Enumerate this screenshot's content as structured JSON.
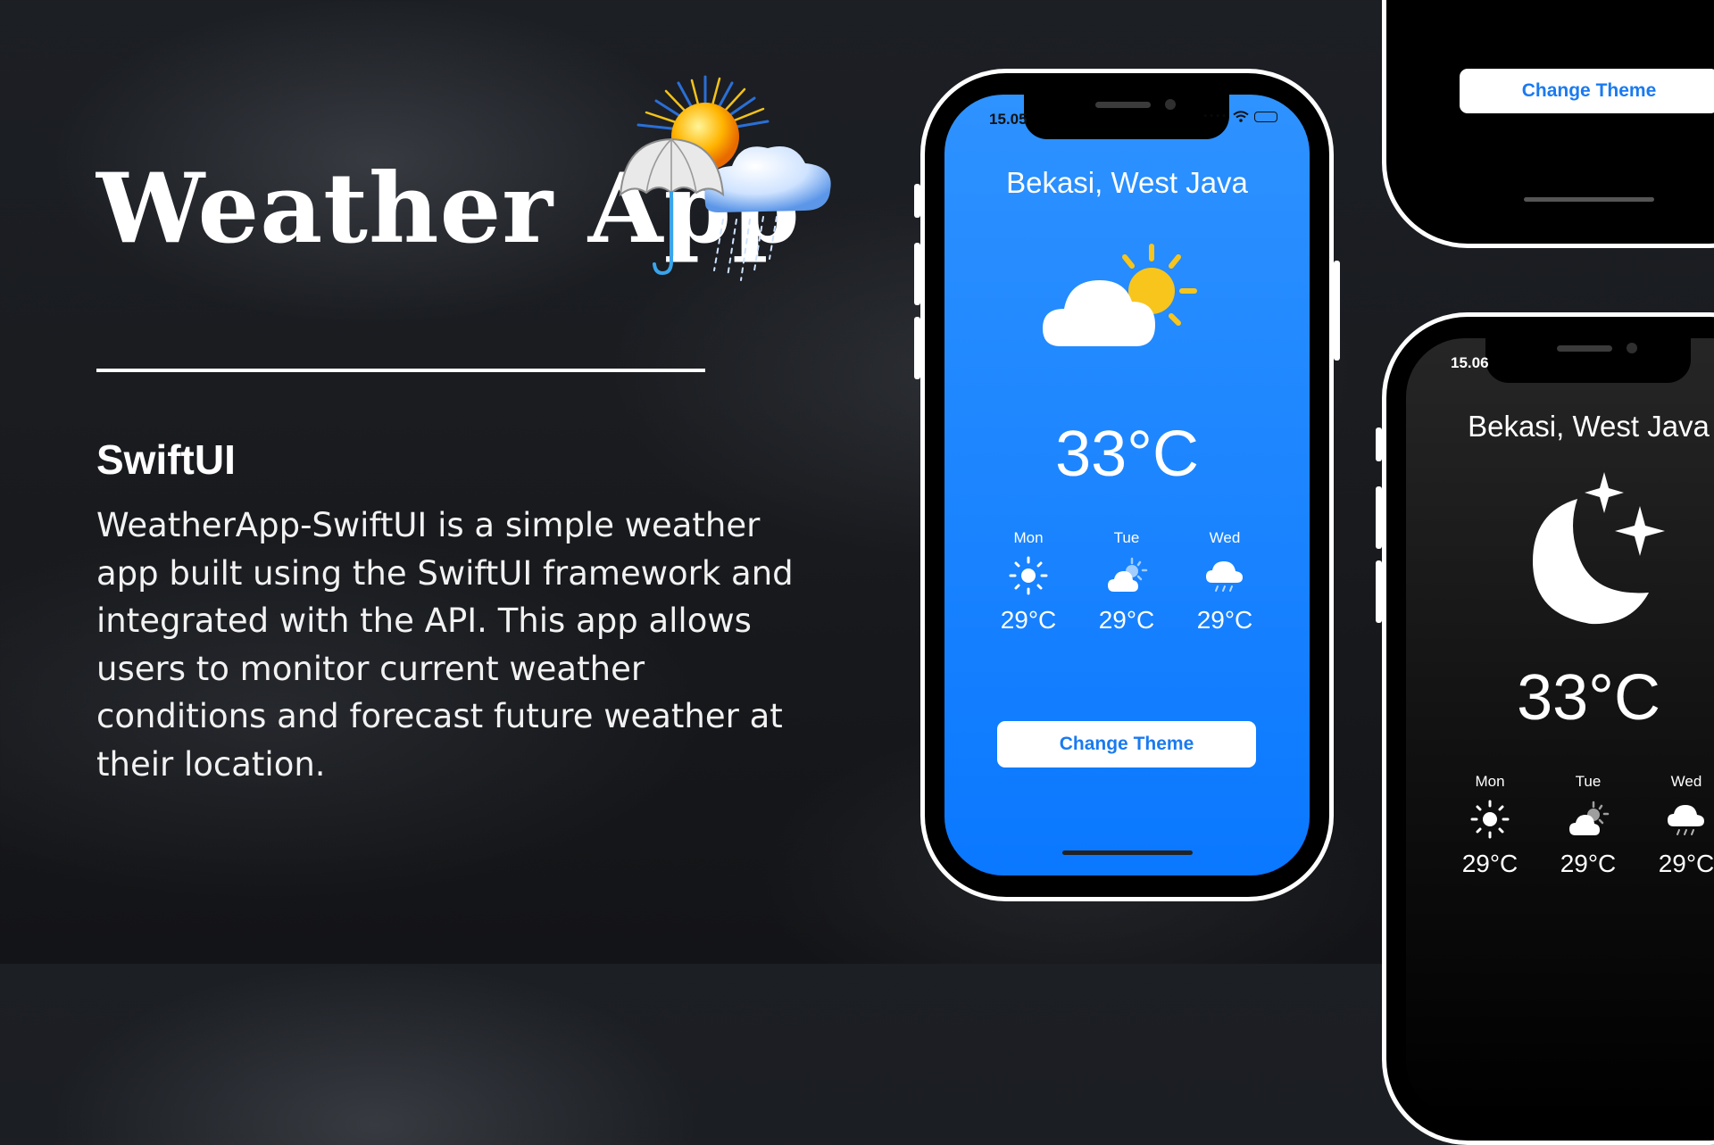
{
  "promo": {
    "title": "Weather App",
    "subtitle": "SwiftUI",
    "description": "WeatherApp-SwiftUI is a simple weather app built using the SwiftUI framework and integrated with the API. This app allows users to monitor current weather conditions and forecast future weather at their location."
  },
  "icons": {
    "logo": "weather-logo-sun-umbrella-cloud",
    "current_light": "partly-cloudy-icon",
    "current_dark": "moon-stars-icon",
    "forecast": [
      "sun-icon",
      "sun-behind-cloud-icon",
      "cloud-drizzle-icon"
    ]
  },
  "colors": {
    "light_screen_top": "#2e92ff",
    "light_screen_bottom": "#0a78ff",
    "dark_screen_top": "#262626",
    "dark_screen_bottom": "#000000",
    "button_text": "#1a7af0",
    "sun": "#f8c51c"
  },
  "phone_light": {
    "status_time": "15.05",
    "city": "Bekasi, West Java",
    "temperature": "33°C",
    "forecast": [
      {
        "day": "Mon",
        "temp": "29°C"
      },
      {
        "day": "Tue",
        "temp": "29°C"
      },
      {
        "day": "Wed",
        "temp": "29°C"
      }
    ],
    "button_label": "Change Theme"
  },
  "phone_top_partial": {
    "button_label": "Change Theme"
  },
  "phone_dark": {
    "status_time": "15.06",
    "city": "Bekasi, West Java",
    "temperature": "33°C",
    "forecast": [
      {
        "day": "Mon",
        "temp": "29°C"
      },
      {
        "day": "Tue",
        "temp": "29°C"
      },
      {
        "day": "Wed",
        "temp": "29°C"
      }
    ]
  }
}
